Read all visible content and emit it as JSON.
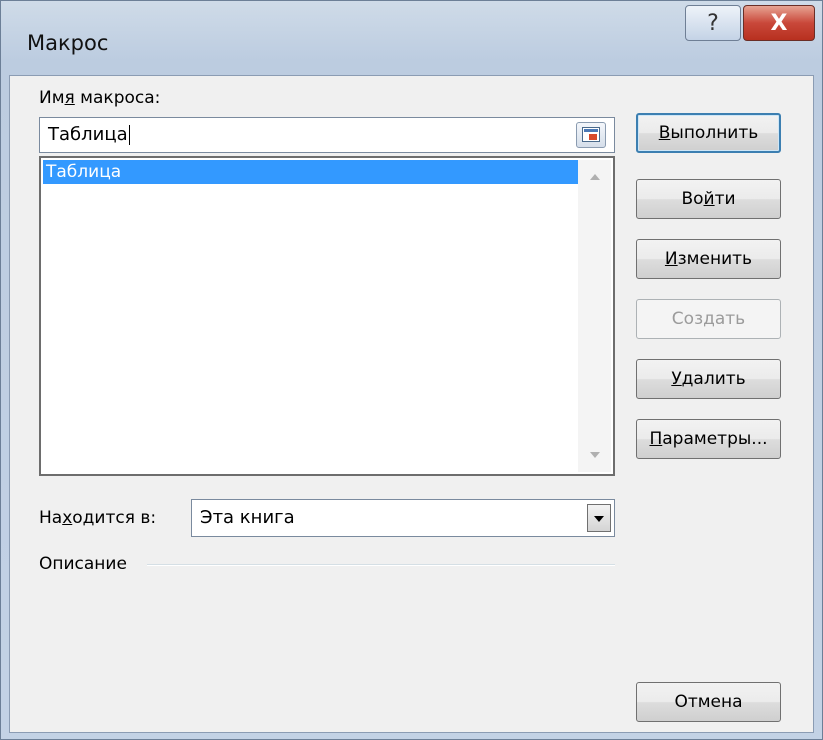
{
  "window": {
    "title": "Макрос",
    "help_glyph": "?",
    "close_glyph": "X"
  },
  "macro_name": {
    "label_pre": "Им",
    "label_u": "я",
    "label_post": " макроса:",
    "value": "Таблица"
  },
  "macro_list": {
    "items": [
      "Таблица"
    ],
    "selected_index": 0
  },
  "buttons": {
    "run": {
      "u": "В",
      "rest": "ыполнить"
    },
    "step_into": {
      "pre": "Во",
      "u": "й",
      "post": "ти"
    },
    "edit": {
      "u": "И",
      "rest": "зменить"
    },
    "create": {
      "label": "Создать",
      "enabled": false
    },
    "delete": {
      "u": "У",
      "rest": "далить"
    },
    "options": {
      "u": "П",
      "rest": "араметры..."
    },
    "cancel": {
      "label": "Отмена"
    }
  },
  "location": {
    "label_pre": "На",
    "label_u": "х",
    "label_post": "одится в:",
    "value": "Эта книга"
  },
  "description": {
    "label": "Описание"
  },
  "colors": {
    "selection": "#3399ff",
    "default_button_border": "#3c7fb1",
    "close_button": "#c9483a"
  }
}
